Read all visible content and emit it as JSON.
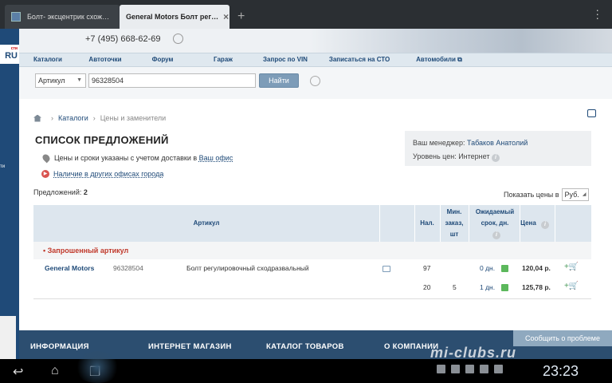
{
  "browser": {
    "tabs": [
      {
        "label": "Болт- эксцентрик схож…",
        "active": false
      },
      {
        "label": "General Motors Болт рег…",
        "active": true
      }
    ],
    "new_tab": "+",
    "close": "×",
    "menu": "⋮"
  },
  "site": {
    "phone": "+7 (495) 668-62-69",
    "logo": "RU",
    "logo_small": "сти",
    "side_text": "ти"
  },
  "nav": [
    "Каталоги",
    "Автоточки",
    "Форум",
    "Гараж",
    "Запрос по VIN",
    "Записаться на СТО",
    "Автомобили"
  ],
  "search": {
    "type": "Артикул",
    "value": "96328504",
    "button": "Найти"
  },
  "breadcrumb": {
    "link": "Каталоги",
    "current": "Цены и заменители"
  },
  "page": {
    "title": "СПИСОК ПРЕДЛОЖЕНИЙ",
    "note_prefix": "Цены и сроки указаны с учетом доставки в",
    "note_link": "Ваш офис",
    "availability_link": "Наличие в других офисах города",
    "offers_label": "Предложений:",
    "offers_count": "2",
    "currency_label": "Показать цены в",
    "currency": "Руб."
  },
  "manager": {
    "label": "Ваш менеджер:",
    "name": "Табаков Анатолий",
    "price_level": "Уровень цен: Интернет"
  },
  "table": {
    "headers": {
      "article": "Артикул",
      "stock": "Нал.",
      "min_order": "Мин. заказ, шт",
      "expected": "Ожидаемый срок, дн.",
      "price": "Цена"
    },
    "requested_label": "Запрошенный артикул",
    "rows": [
      {
        "brand": "General Motors",
        "article": "96328504",
        "description": "Болт регулировочный сходразвальный",
        "stock": "97",
        "min": "",
        "days": "0 дн.",
        "price": "120,04 р."
      },
      {
        "brand": "",
        "article": "",
        "description": "",
        "stock": "20",
        "min": "5",
        "days": "1 дн.",
        "price": "125,78 р."
      }
    ]
  },
  "footer": {
    "items": [
      "ИНФОРМАЦИЯ",
      "ИНТЕРНЕТ МАГАЗИН",
      "КАТАЛОГ ТОВАРОВ",
      "О КОМПАНИИ"
    ],
    "report": "Сообщить о проблеме"
  },
  "system": {
    "time": "23:23",
    "watermark": "mi-clubs.ru"
  }
}
